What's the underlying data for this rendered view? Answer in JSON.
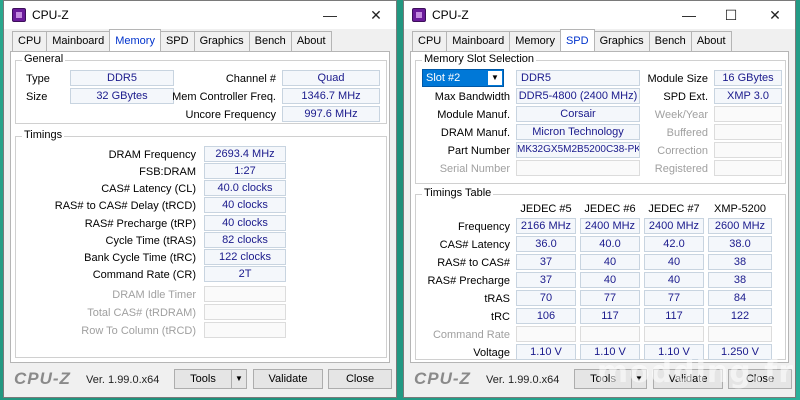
{
  "left": {
    "title": "CPU-Z",
    "tabs": [
      "CPU",
      "Mainboard",
      "Memory",
      "SPD",
      "Graphics",
      "Bench",
      "About"
    ],
    "active_tab": "Memory",
    "general": {
      "legend": "General",
      "type_label": "Type",
      "type_value": "DDR5",
      "size_label": "Size",
      "size_value": "32 GBytes",
      "channel_label": "Channel #",
      "channel_value": "Quad",
      "mem_ctrl_label": "Mem Controller Freq.",
      "mem_ctrl_value": "1346.7 MHz",
      "uncore_label": "Uncore Frequency",
      "uncore_value": "997.6 MHz"
    },
    "timings": {
      "legend": "Timings",
      "rows": [
        {
          "label": "DRAM Frequency",
          "value": "2693.4 MHz"
        },
        {
          "label": "FSB:DRAM",
          "value": "1:27"
        },
        {
          "label": "CAS# Latency (CL)",
          "value": "40.0 clocks"
        },
        {
          "label": "RAS# to CAS# Delay (tRCD)",
          "value": "40 clocks"
        },
        {
          "label": "RAS# Precharge (tRP)",
          "value": "40 clocks"
        },
        {
          "label": "Cycle Time (tRAS)",
          "value": "82 clocks"
        },
        {
          "label": "Bank Cycle Time (tRC)",
          "value": "122 clocks"
        },
        {
          "label": "Command Rate (CR)",
          "value": "2T"
        },
        {
          "label": "DRAM Idle Timer",
          "value": ""
        },
        {
          "label": "Total CAS# (tRDRAM)",
          "value": ""
        },
        {
          "label": "Row To Column (tRCD)",
          "value": ""
        }
      ]
    },
    "brand": "CPU-Z",
    "version": "Ver. 1.99.0.x64",
    "tools_label": "Tools",
    "validate_label": "Validate",
    "close_label": "Close"
  },
  "right": {
    "title": "CPU-Z",
    "tabs": [
      "CPU",
      "Mainboard",
      "Memory",
      "SPD",
      "Graphics",
      "Bench",
      "About"
    ],
    "active_tab": "SPD",
    "slot": {
      "legend": "Memory Slot Selection",
      "selected": "Slot #2",
      "type_value": "DDR5",
      "module_size_label": "Module Size",
      "module_size_value": "16 GBytes",
      "max_bw_label": "Max Bandwidth",
      "max_bw_value": "DDR5-4800 (2400 MHz)",
      "spd_ext_label": "SPD Ext.",
      "spd_ext_value": "XMP 3.0",
      "module_manuf_label": "Module Manuf.",
      "module_manuf_value": "Corsair",
      "week_year_label": "Week/Year",
      "dram_manuf_label": "DRAM Manuf.",
      "dram_manuf_value": "Micron Technology",
      "buffered_label": "Buffered",
      "part_label": "Part Number",
      "part_value": "MK32GX5M2B5200C38-PK",
      "correction_label": "Correction",
      "serial_label": "Serial Number",
      "registered_label": "Registered"
    },
    "timings_table": {
      "legend": "Timings Table",
      "columns": [
        "JEDEC #5",
        "JEDEC #6",
        "JEDEC #7",
        "XMP-5200"
      ],
      "rows": [
        {
          "label": "Frequency",
          "values": [
            "2166 MHz",
            "2400 MHz",
            "2400 MHz",
            "2600 MHz"
          ]
        },
        {
          "label": "CAS# Latency",
          "values": [
            "36.0",
            "40.0",
            "42.0",
            "38.0"
          ]
        },
        {
          "label": "RAS# to CAS#",
          "values": [
            "37",
            "40",
            "40",
            "38"
          ]
        },
        {
          "label": "RAS# Precharge",
          "values": [
            "37",
            "40",
            "40",
            "38"
          ]
        },
        {
          "label": "tRAS",
          "values": [
            "70",
            "77",
            "77",
            "84"
          ]
        },
        {
          "label": "tRC",
          "values": [
            "106",
            "117",
            "117",
            "122"
          ]
        },
        {
          "label": "Command Rate",
          "values": [
            "",
            "",
            "",
            ""
          ]
        },
        {
          "label": "Voltage",
          "values": [
            "1.10 V",
            "1.10 V",
            "1.10 V",
            "1.250 V"
          ]
        }
      ]
    },
    "brand": "CPU-Z",
    "version": "Ver. 1.99.0.x64",
    "tools_label": "Tools",
    "validate_label": "Validate",
    "close_label": "Close"
  },
  "watermark": "modding.fr"
}
